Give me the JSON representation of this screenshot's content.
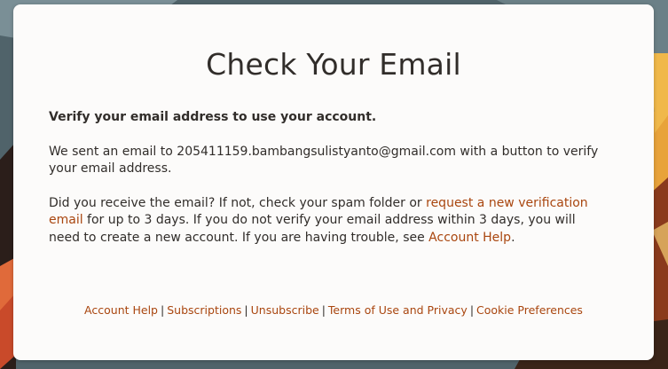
{
  "page": {
    "title": "Check Your Email"
  },
  "content": {
    "lead": "Verify your email address to use your account.",
    "sent_prefix": "We sent an email to ",
    "email": "205411159.bambangsulistyanto@gmail.com",
    "sent_suffix": " with a button to verify your email address.",
    "help_part1": "Did you receive the email? If not, check your spam folder or ",
    "request_link": "request a new verification email",
    "help_part2": " for up to 3 days. If you do not verify your email address within 3 days, you will need to create a new account. If you are having trouble, see ",
    "account_help_link": "Account Help",
    "help_part3": "."
  },
  "footer": {
    "links": [
      "Account Help",
      "Subscriptions",
      "Unsubscribe",
      "Terms of Use and Privacy",
      "Cookie Preferences"
    ],
    "separator": "|"
  },
  "colors": {
    "link": "#a9460f",
    "text": "#312d2a",
    "card": "#fcfbfa"
  }
}
